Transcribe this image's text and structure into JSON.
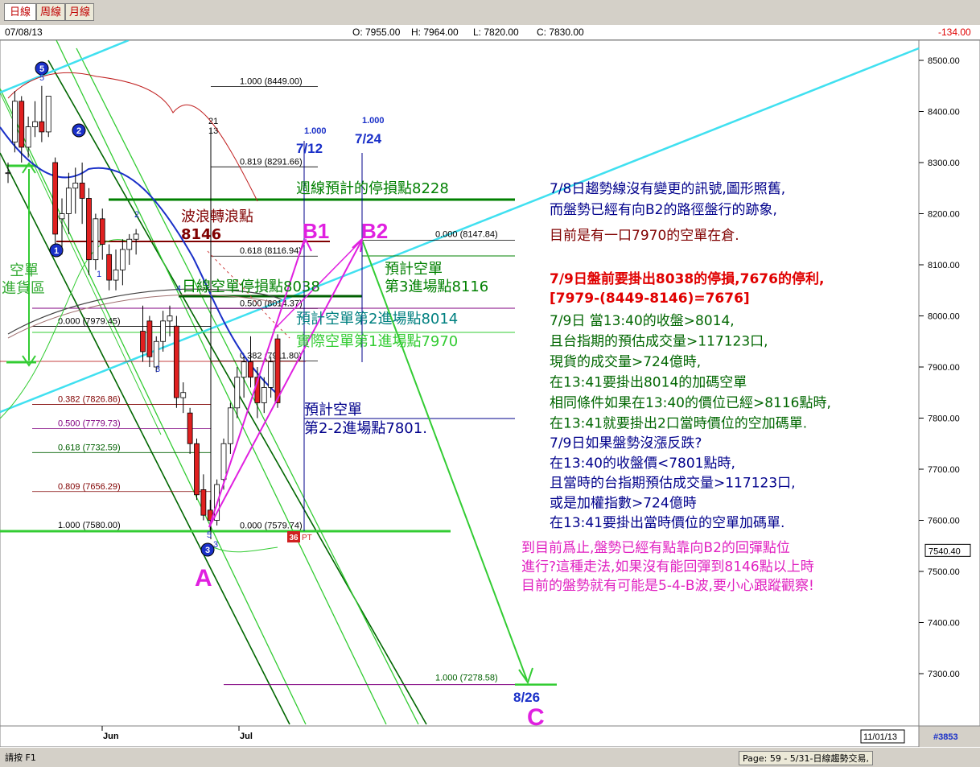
{
  "tabs": [
    "日線",
    "周線",
    "月線"
  ],
  "info": {
    "date": "07/08/13",
    "open": "O: 7955.00",
    "high": "H: 7964.00",
    "low": "L: 7820.00",
    "close": "C: 7830.00",
    "change": "-134.00"
  },
  "colors": {
    "fib_line": "#000000",
    "support_green": "#33cc33",
    "channel_dark": "#006600",
    "cyan_trend": "#40e0f0",
    "magenta_path": "#e020e0",
    "down_candle": "#e02020",
    "up_candle": "#ffffff",
    "ma_blue": "#1a30c8",
    "ma_red": "#c02020"
  },
  "chart_data": {
    "type": "candlestick",
    "ylim": [
      7200,
      8540
    ],
    "y_ticks": [
      "8500.00",
      "8400.00",
      "8300.00",
      "8200.00",
      "8100.00",
      "8000.00",
      "7900.00",
      "7800.00",
      "7700.00",
      "7600.00",
      "7500.00",
      "7400.00",
      "7300.00"
    ],
    "last_price_tag": "7540.40",
    "x_labels": [
      "Jun",
      "Jul"
    ],
    "end_date_label": "11/01/13",
    "bar_count_label": "#3853",
    "candles": [
      [
        8280,
        8300,
        8260,
        8280
      ],
      [
        8340,
        8440,
        8320,
        8420
      ],
      [
        8420,
        8430,
        8300,
        8330
      ],
      [
        8330,
        8390,
        8310,
        8370
      ],
      [
        8370,
        8420,
        8350,
        8380
      ],
      [
        8380,
        8450,
        8340,
        8360
      ],
      [
        8360,
        8430,
        8350,
        8430
      ],
      [
        8300,
        8310,
        8130,
        8160
      ],
      [
        8190,
        8230,
        8120,
        8200
      ],
      [
        8200,
        8280,
        8160,
        8250
      ],
      [
        8250,
        8290,
        8200,
        8260
      ],
      [
        8260,
        8300,
        8180,
        8230
      ],
      [
        8230,
        8250,
        8080,
        8110
      ],
      [
        8110,
        8200,
        8090,
        8190
      ],
      [
        8190,
        8210,
        8110,
        8140
      ],
      [
        8120,
        8140,
        8050,
        8070
      ],
      [
        8070,
        8130,
        8050,
        8090
      ],
      [
        8090,
        8150,
        8060,
        8130
      ],
      [
        8130,
        8160,
        8100,
        8150
      ],
      [
        8150,
        8170,
        8120,
        8160
      ],
      [
        7970,
        8020,
        7910,
        7930
      ],
      [
        7990,
        8000,
        7900,
        7920
      ],
      [
        7900,
        7960,
        7890,
        7950
      ],
      [
        7950,
        8010,
        7930,
        7990
      ],
      [
        7990,
        8020,
        7960,
        8000
      ],
      [
        7980,
        8000,
        7820,
        7840
      ],
      [
        7840,
        7870,
        7810,
        7850
      ],
      [
        7810,
        7820,
        7730,
        7750
      ],
      [
        7750,
        7760,
        7640,
        7650
      ],
      [
        7660,
        7690,
        7600,
        7610
      ],
      [
        7620,
        7640,
        7580,
        7600
      ],
      [
        7600,
        7680,
        7590,
        7670
      ],
      [
        7680,
        7760,
        7660,
        7750
      ],
      [
        7750,
        7830,
        7730,
        7820
      ],
      [
        7820,
        7900,
        7800,
        7880
      ],
      [
        7880,
        7920,
        7840,
        7910
      ],
      [
        7910,
        7960,
        7860,
        7880
      ],
      [
        7880,
        7900,
        7800,
        7830
      ],
      [
        7830,
        7880,
        7810,
        7860
      ],
      [
        7860,
        7920,
        7840,
        7910
      ],
      [
        7955,
        7964,
        7820,
        7830
      ]
    ],
    "fib_levels_upper": [
      {
        "label": "1.000 (8449.00)",
        "value": 8449.0
      },
      {
        "label": "0.819 (8291.66)",
        "value": 8291.66
      },
      {
        "label": "0.618 (8116.94)",
        "value": 8116.94
      },
      {
        "label": "0.500 (8014.37)",
        "value": 8014.37
      },
      {
        "label": "0.382 (7911.80)",
        "value": 7911.8
      },
      {
        "label": "0.000 (7579.74)",
        "value": 7579.74
      }
    ],
    "fib_levels_lower": [
      {
        "label": "0.000 (7979.45)",
        "value": 7979.45
      },
      {
        "label": "0.382 (7826.86)",
        "value": 7826.86
      },
      {
        "label": "0.500 (7779.73)",
        "value": 7779.73
      },
      {
        "label": "0.618 (7732.59)",
        "value": 7732.59
      },
      {
        "label": "0.809 (7656.29)",
        "value": 7656.29
      },
      {
        "label": "1.000 (7580.00)",
        "value": 7580.0
      }
    ],
    "fib_level_b2": {
      "label": "0.000 (8147.84)",
      "value": 8147.84
    },
    "fib_level_c": {
      "label": "1.000 (7278.58)",
      "value": 7278.58
    },
    "time_fibs": [
      {
        "top": "1.000",
        "date": "7/12"
      },
      {
        "top": "1.000",
        "date": "7/24"
      }
    ],
    "marker_21": "21",
    "marker_13": "13",
    "wave_points": [
      {
        "label": "A",
        "value": 7580
      },
      {
        "label": "B1",
        "value": 8150
      },
      {
        "label": "B2",
        "value": 8147.84
      },
      {
        "label": "C",
        "value": 7278.58
      }
    ],
    "date_c": "8/26",
    "wave_numbers_circled": [
      "5",
      "2",
      "1",
      "3"
    ],
    "wave_numbers_small": [
      "5",
      "1",
      "2",
      "3",
      "4",
      "5",
      "3"
    ],
    "pts_badge": "36",
    "pts_suffix": "PT"
  },
  "annotations": {
    "weekly_stop": "週線預計的停損點8228",
    "wave_turn": "波浪轉浪點",
    "wave_turn_value": "8146",
    "daily_stop": "日線空單停損點8038",
    "short_zone": [
      "空單",
      "進貨區"
    ],
    "plan3": [
      "預計空單",
      "第3進場點8116"
    ],
    "plan2": "預計空單第2進場點8014",
    "actual1": "實際空單第1進場點7970",
    "plan22": [
      "預計空單",
      "第2-2進場點7801."
    ],
    "note1": [
      "7/8日趨勢線沒有變更的訊號,圖形照舊,",
      "而盤勢已經有向B2的路徑盤行的跡象,"
    ],
    "note2": "目前是有一口7970的空單在倉.",
    "note3": [
      "7/9日盤前要掛出8038的停損,7676的停利,",
      "[7979-(8449-8146)=7676]"
    ],
    "note4": [
      "7/9日 當13:40的收盤>8014,",
      "且台指期的預估成交量>117123口,",
      "現貨的成交量>724億時,",
      "在13:41要掛出8014的加碼空單",
      "相同條件如果在13:40的價位已經>8116點時,",
      "在13:41就要掛出2口當時價位的空加碼單."
    ],
    "note5": [
      "7/9日如果盤勢沒漲反跌?",
      "在13:40的收盤價<7801點時,",
      "且當時的台指期預估成交量>117123口,",
      "或是加權指數>724億時",
      "在13:41要掛出當時價位的空單加碼單."
    ],
    "note6": [
      "到目前爲止,盤勢已經有點靠向B2的回彈點位",
      "進行?這種走法,如果沒有能回彈到8146點以上時",
      "目前的盤勢就有可能是5-4-B波,要小心跟蹤觀察!"
    ]
  },
  "status": {
    "left": "請按 F1",
    "page": "Page: 59 - 5/31-日線趨勢交易,"
  }
}
